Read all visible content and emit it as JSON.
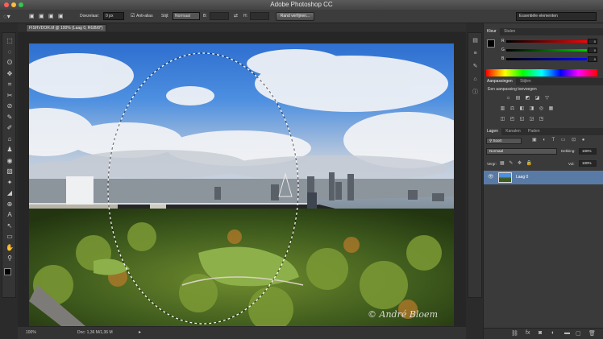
{
  "window": {
    "title": "Adobe Photoshop CC"
  },
  "options": {
    "feather_label": "Doezelaar:",
    "feather_value": "0 px",
    "antialias_label": "Anti-alias",
    "style_label": "Stijl:",
    "style_value": "Normaal",
    "width_label": "B:",
    "height_label": "H:",
    "refine_button": "Rand verfijnen...",
    "workspace": "Essentiële elementen"
  },
  "document": {
    "tab": "FISHVDOR.tif @ 100% (Laag 0, RGB/8*)",
    "zoom": "100%",
    "doc_info": "Doc: 1,36 M/1,36 M",
    "watermark": "© André Bloem"
  },
  "color_panel": {
    "tabs": [
      "Kleur",
      "Stalen"
    ],
    "channels": [
      {
        "label": "R",
        "value": "0",
        "color": "#ff0000"
      },
      {
        "label": "G",
        "value": "0",
        "color": "#00cc00"
      },
      {
        "label": "B",
        "value": "0",
        "color": "#0000ff"
      }
    ]
  },
  "adjustments_panel": {
    "tabs": [
      "Aanpassingen",
      "Stijlen"
    ],
    "hint": "Een aanpassing toevoegen",
    "icons_row1": [
      "☼",
      "▤",
      "◩",
      "◪",
      "▽"
    ],
    "icons_row2": [
      "▥",
      "⚖",
      "◧",
      "◨",
      "◎",
      "▦"
    ],
    "icons_row3": [
      "◫",
      "◰",
      "◱",
      "◲",
      "◳"
    ]
  },
  "layers_panel": {
    "tabs": [
      "Lagen",
      "Kanalen",
      "Paden"
    ],
    "kind_filter": "Soort",
    "blend_mode": "Normaal",
    "opacity_label": "Dekking:",
    "opacity_value": "100%",
    "lock_label": "Vergr:",
    "fill_label": "Vul:",
    "fill_value": "100%",
    "layers": [
      {
        "name": "Laag 0",
        "visible": true
      }
    ]
  },
  "tools": [
    "⬚",
    "◌",
    "ʘ",
    "✥",
    "⌗",
    "✂",
    "⊘",
    "✎",
    "✐",
    "⌂",
    "♟",
    "◉",
    "▧",
    "✦",
    "◢",
    "⊕",
    "A",
    "↖",
    "▭",
    "✋",
    "⚲"
  ],
  "colors": {
    "foreground": "#000000",
    "background": "#ffffff",
    "accent": "#5a7aa6"
  }
}
